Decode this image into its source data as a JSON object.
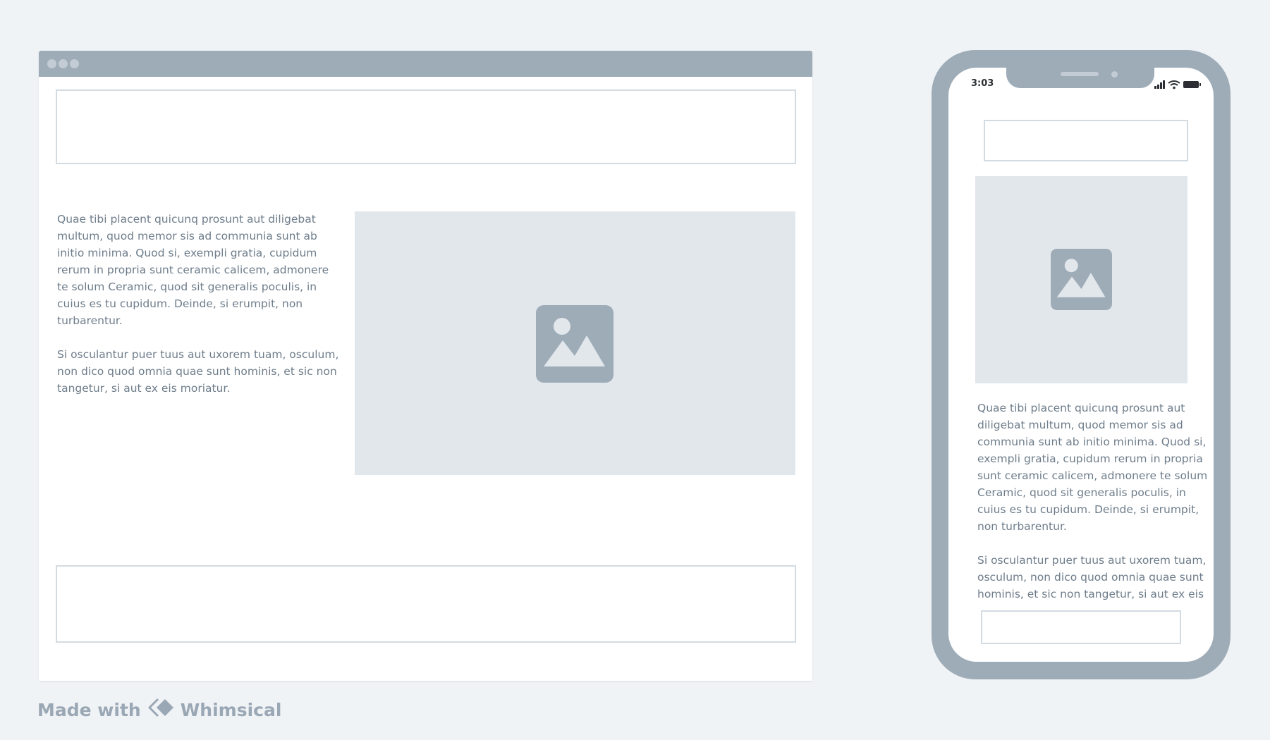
{
  "desktop": {
    "text": {
      "paragraph_1": "Quae tibi placent quicunq prosunt aut diligebat multum, quod memor sis ad communia sunt ab initio minima. Quod si, exempli gratia, cupidum rerum in propria sunt ceramic calicem, admonere te solum Ceramic, quod sit generalis poculis, in cuius es tu cupidum. Deinde, si erumpit, non turbarentur.",
      "paragraph_2": "Si osculantur puer tuus aut uxorem tuam, osculum, non dico quod omnia quae sunt hominis, et sic non tangetur, si aut ex eis moriatur."
    },
    "image_icon": "image-placeholder-icon"
  },
  "phone": {
    "time": "3:03",
    "status_icons": [
      "signal-icon",
      "wifi-icon",
      "battery-icon"
    ],
    "text": {
      "paragraph_1": "Quae tibi placent quicunq prosunt aut diligebat multum, quod memor sis ad communia sunt ab initio minima. Quod si, exempli gratia, cupidum rerum in propria sunt ceramic calicem, admonere te solum Ceramic, quod sit generalis poculis, in cuius es tu cupidum. Deinde, si erumpit, non turbarentur.",
      "paragraph_2": "Si osculantur puer tuus aut uxorem tuam, osculum, non dico quod omnia quae sunt hominis, et sic non tangetur, si aut ex eis"
    },
    "image_icon": "image-placeholder-icon"
  },
  "footer": {
    "made_with": "Made with",
    "brand": "Whimsical"
  },
  "colors": {
    "background": "#f0f3f6",
    "frame": "#9eacb8",
    "placeholder": "#e2e7ec",
    "box_border": "#d3dbe2",
    "text": "#6e7d8b",
    "footer_text": "#9aa7b4"
  }
}
